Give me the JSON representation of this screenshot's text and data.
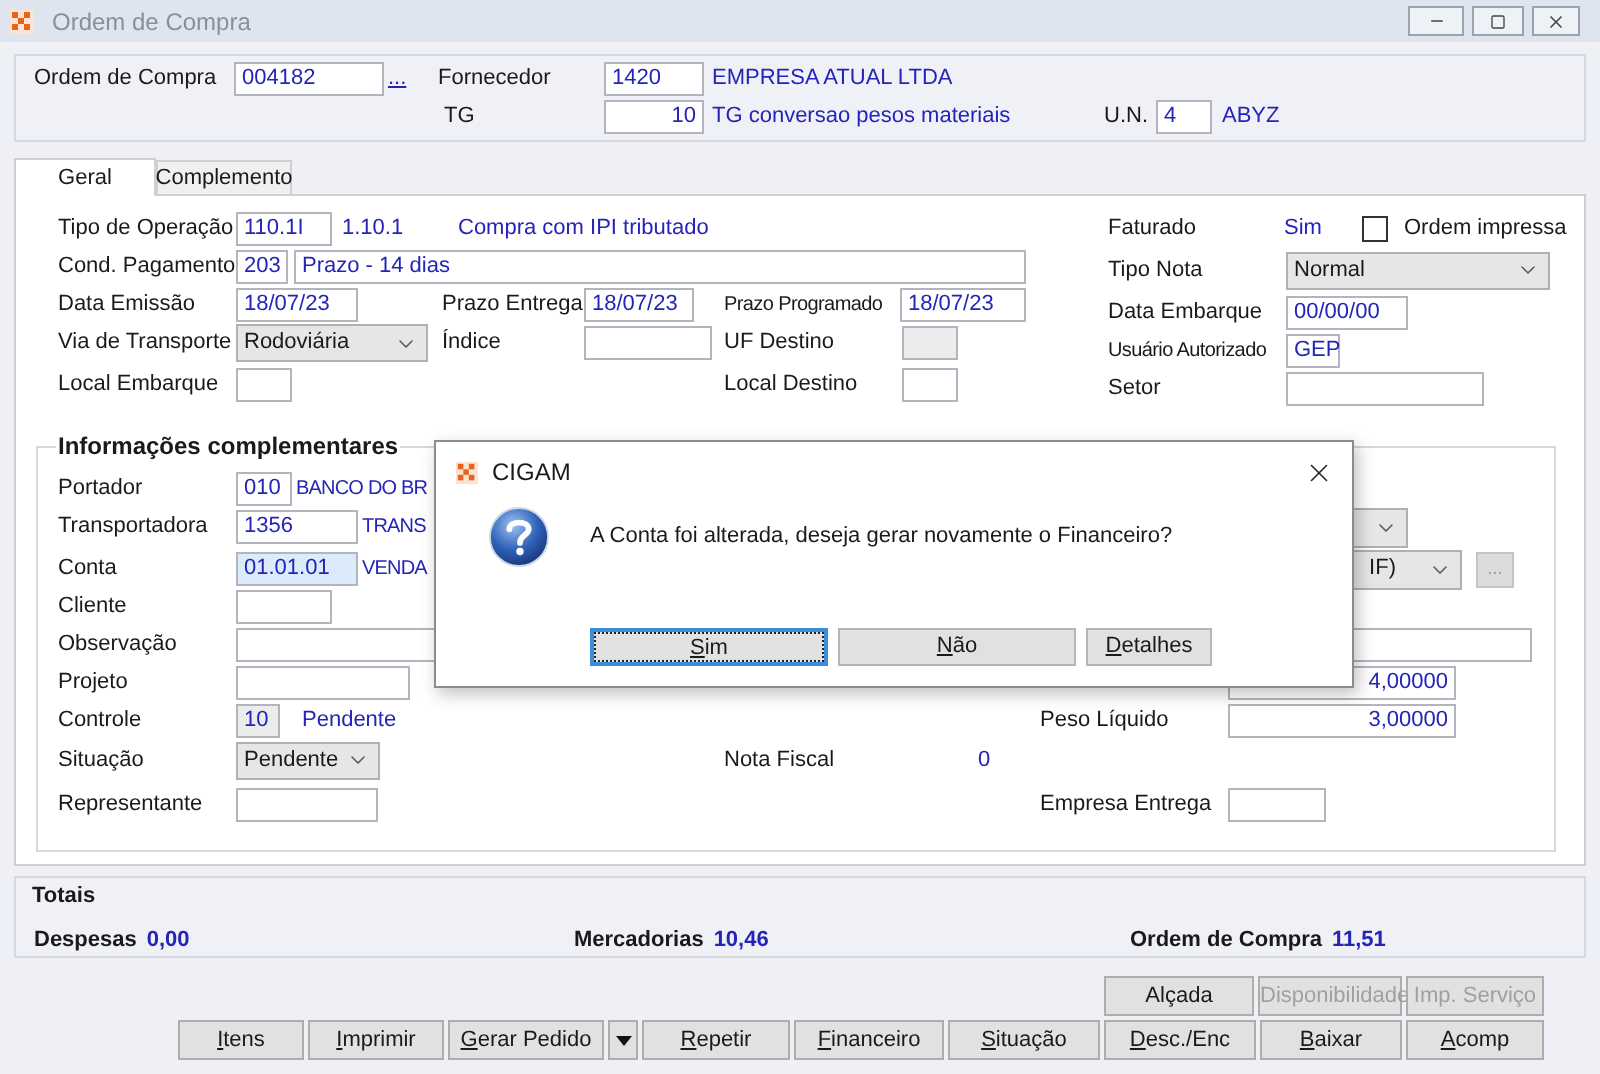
{
  "window": {
    "title": "Ordem de Compra"
  },
  "header": {
    "ordem_label": "Ordem de Compra",
    "ordem_value": "004182",
    "lookup": "...",
    "fornecedor_label": "Fornecedor",
    "fornecedor_code": "1420",
    "fornecedor_name": "EMPRESA ATUAL LTDA",
    "tg_label": "TG",
    "tg_code": "10",
    "tg_name": "TG conversao pesos materiais",
    "un_label": "U.N.",
    "un_code": "4",
    "un_name": "ABYZ"
  },
  "tabs": [
    {
      "label": "Geral",
      "selected": true
    },
    {
      "label": "Complemento",
      "selected": false
    }
  ],
  "geral": {
    "tipo_operacao": {
      "label": "Tipo de Operação",
      "code": "110.1I",
      "ref": "1.10.1",
      "desc": "Compra com IPI tributado"
    },
    "cond_pagamento": {
      "label": "Cond. Pagamento",
      "code": "203",
      "desc": "Prazo - 14 dias"
    },
    "data_emissao": {
      "label": "Data Emissão",
      "value": "18/07/23"
    },
    "prazo_entrega": {
      "label": "Prazo Entrega",
      "value": "18/07/23"
    },
    "prazo_programado": {
      "label": "Prazo Programado",
      "value": "18/07/23"
    },
    "via_transporte": {
      "label": "Via de Transporte",
      "value": "Rodoviária"
    },
    "indice": {
      "label": "Índice"
    },
    "uf_destino": {
      "label": "UF Destino",
      "disabled": true
    },
    "local_embarque": {
      "label": "Local Embarque"
    },
    "local_destino": {
      "label": "Local Destino"
    },
    "faturado": {
      "label": "Faturado",
      "value": "Sim"
    },
    "ordem_impressa": {
      "label": "Ordem impressa",
      "checked": false
    },
    "tipo_nota": {
      "label": "Tipo Nota",
      "value": "Normal"
    },
    "data_embarque": {
      "label": "Data Embarque",
      "value": "00/00/00"
    },
    "usuario": {
      "label": "Usuário Autorizado",
      "value": "GEP"
    },
    "setor": {
      "label": "Setor"
    }
  },
  "complementares": {
    "title": "Informações complementares",
    "portador": {
      "label": "Portador",
      "code": "010",
      "name": "BANCO DO BR"
    },
    "transportadora": {
      "label": "Transportadora",
      "code": "1356",
      "name": "TRANS"
    },
    "conta": {
      "label": "Conta",
      "code": "01.01.01",
      "name": "VENDA",
      "highlighted": true
    },
    "cliente": {
      "label": "Cliente"
    },
    "observacao": {
      "label": "Observação"
    },
    "projeto": {
      "label": "Projeto"
    },
    "controle": {
      "label": "Controle",
      "code": "10",
      "status": "Pendente"
    },
    "situacao": {
      "label": "Situação",
      "value": "Pendente"
    },
    "nota_fiscal": {
      "label": "Nota Fiscal",
      "value": "0"
    },
    "representante": {
      "label": "Representante"
    },
    "frete": {
      "value": "IF)"
    },
    "frete_lookup": {
      "label": "...",
      "disabled": true
    },
    "peso_bruto": {
      "value": "4,00000"
    },
    "peso_liquido": {
      "label": "Peso Líquido",
      "value": "3,00000"
    },
    "empresa_entrega": {
      "label": "Empresa Entrega"
    }
  },
  "totais": {
    "title": "Totais",
    "items": [
      {
        "label": "Despesas",
        "value": "0,00"
      },
      {
        "label": "Mercadorias",
        "value": "10,46"
      },
      {
        "label": "Ordem de Compra",
        "value": "11,51"
      }
    ]
  },
  "buttons_top": [
    {
      "label": "Alçada",
      "disabled": false,
      "mnemonic": false
    },
    {
      "label": "Disponibilidade",
      "disabled": true,
      "mnemonic": false
    },
    {
      "label": "Imp. Serviço",
      "disabled": true,
      "mnemonic": false
    }
  ],
  "buttons": [
    {
      "kind": "button",
      "label": "Itens",
      "mnemonic": true
    },
    {
      "kind": "button",
      "label": "Imprimir",
      "mnemonic": true
    },
    {
      "kind": "button",
      "label": "Gerar Pedido",
      "mnemonic": true
    },
    {
      "kind": "arrow"
    },
    {
      "kind": "button",
      "label": "Repetir",
      "mnemonic": true
    },
    {
      "kind": "button",
      "label": "Financeiro",
      "mnemonic": true
    },
    {
      "kind": "button",
      "label": "Situação",
      "mnemonic": true
    },
    {
      "kind": "button",
      "label": "Desc./Enc",
      "mnemonic": true
    },
    {
      "kind": "button",
      "label": "Baixar",
      "mnemonic": true
    },
    {
      "kind": "button",
      "label": "Acomp",
      "mnemonic": true
    }
  ],
  "dialog": {
    "title": "CIGAM",
    "message": "A Conta foi alterada, deseja gerar novamente o Financeiro?",
    "buttons": [
      {
        "label": "Sim",
        "focused": true,
        "mnemonic": true
      },
      {
        "label": "Não",
        "focused": false,
        "mnemonic": true
      },
      {
        "label": "Detalhes",
        "focused": false,
        "mnemonic": true
      }
    ]
  }
}
